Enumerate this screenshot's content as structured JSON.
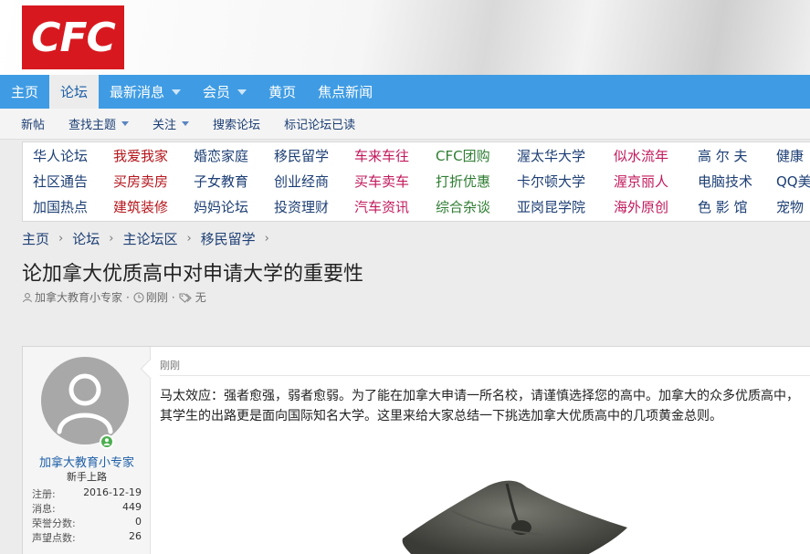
{
  "header": {
    "logo_text": "CFC"
  },
  "nav": [
    {
      "label": "主页",
      "active": false,
      "dropdown": false
    },
    {
      "label": "论坛",
      "active": true,
      "dropdown": false
    },
    {
      "label": "最新消息",
      "active": false,
      "dropdown": true
    },
    {
      "label": "会员",
      "active": false,
      "dropdown": true
    },
    {
      "label": "黄页",
      "active": false,
      "dropdown": false
    },
    {
      "label": "焦点新闻",
      "active": false,
      "dropdown": false
    }
  ],
  "subnav": [
    {
      "label": "新帖",
      "dropdown": false
    },
    {
      "label": "查找主题",
      "dropdown": true
    },
    {
      "label": "关注",
      "dropdown": true
    },
    {
      "label": "搜索论坛",
      "dropdown": false
    },
    {
      "label": "标记论坛已读",
      "dropdown": false
    }
  ],
  "forum_links": [
    [
      {
        "label": "华人论坛",
        "color": "#1d3f75"
      },
      {
        "label": "我爱我家",
        "color": "#b5161c"
      },
      {
        "label": "婚恋家庭",
        "color": "#1d3f75"
      },
      {
        "label": "移民留学",
        "color": "#1d3f75"
      },
      {
        "label": "车来车往",
        "color": "#c2185b"
      },
      {
        "label": "CFC团购",
        "color": "#2e7d32"
      },
      {
        "label": "渥太华大学",
        "color": "#1d3f75"
      },
      {
        "label": "似水流年",
        "color": "#c2185b"
      },
      {
        "label": "高 尔 夫",
        "color": "#1d3f75"
      },
      {
        "label": "健康",
        "color": "#1d3f75"
      }
    ],
    [
      {
        "label": "社区通告",
        "color": "#1d3f75"
      },
      {
        "label": "买房卖房",
        "color": "#b5161c"
      },
      {
        "label": "子女教育",
        "color": "#1d3f75"
      },
      {
        "label": "创业经商",
        "color": "#1d3f75"
      },
      {
        "label": "买车卖车",
        "color": "#c2185b"
      },
      {
        "label": "打折优惠",
        "color": "#2e7d32"
      },
      {
        "label": "卡尔顿大学",
        "color": "#1d3f75"
      },
      {
        "label": "渥京丽人",
        "color": "#c2185b"
      },
      {
        "label": "电脑技术",
        "color": "#1d3f75"
      },
      {
        "label": "QQ美",
        "color": "#1d3f75"
      }
    ],
    [
      {
        "label": "加国热点",
        "color": "#1d3f75"
      },
      {
        "label": "建筑装修",
        "color": "#b5161c"
      },
      {
        "label": "妈妈论坛",
        "color": "#1d3f75"
      },
      {
        "label": "投资理财",
        "color": "#1d3f75"
      },
      {
        "label": "汽车资讯",
        "color": "#c2185b"
      },
      {
        "label": "综合杂谈",
        "color": "#2e7d32"
      },
      {
        "label": "亚岗昆学院",
        "color": "#1d3f75"
      },
      {
        "label": "海外原创",
        "color": "#c2185b"
      },
      {
        "label": "色 影 馆",
        "color": "#1d3f75"
      },
      {
        "label": "宠物",
        "color": "#1d3f75"
      }
    ]
  ],
  "breadcrumb": [
    "主页",
    "论坛",
    "主论坛区",
    "移民留学"
  ],
  "thread": {
    "title": "论加拿大优质高中对申请大学的重要性",
    "author": "加拿大教育小专家",
    "time": "刚刚",
    "tags": "无"
  },
  "post": {
    "username": "加拿大教育小专家",
    "user_title": "新手上路",
    "stats": [
      {
        "label": "注册:",
        "value": "2016-12-19"
      },
      {
        "label": "消息:",
        "value": "449"
      },
      {
        "label": "荣誉分数:",
        "value": "0"
      },
      {
        "label": "声望点数:",
        "value": "26"
      }
    ],
    "time": "刚刚",
    "body": "马太效应：强者愈强，弱者愈弱。为了能在加拿大申请一所名校，请谨慎选择您的高中。加拿大的众多优质高中，其学生的出路更是面向国际知名大学。这里来给大家总结一下挑选加拿大优质高中的几项黄金总则。"
  },
  "colors": {
    "nav_bg": "#3f9ce4",
    "logo_bg": "#d7191f",
    "link_blue": "#1d3f75"
  }
}
